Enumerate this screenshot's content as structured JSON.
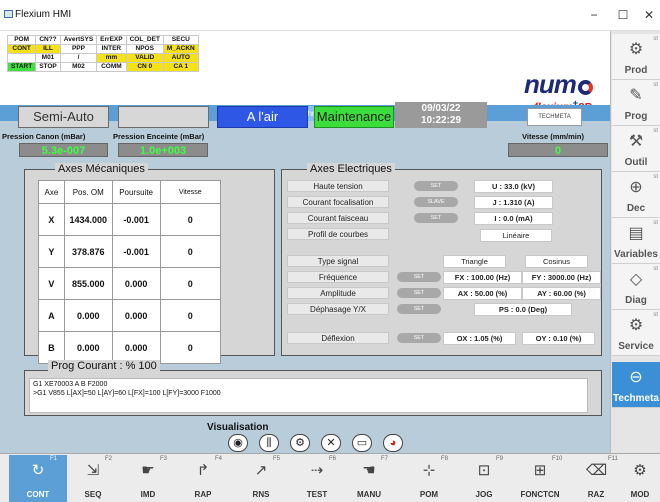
{
  "window": {
    "title": "Flexium HMI",
    "min": "−",
    "max": "☐",
    "close": "✕"
  },
  "status_grid": [
    [
      "POM",
      "CN??",
      "AvertSYS",
      "ErrEXP",
      "COL_DET",
      "SECU"
    ],
    [
      "CONT",
      "ILL",
      "PPP",
      "INTER",
      "NPOS",
      "M_ACKN"
    ],
    [
      "",
      "M01",
      "/",
      "mm",
      "VALID",
      "AUTO"
    ],
    [
      "START",
      "STOP",
      "M02",
      "COMM",
      "CN 0",
      "CA 1"
    ]
  ],
  "logo": {
    "main": "num",
    "sub_left": "flexium",
    "sub_plus": "+",
    "sub_right": "8B"
  },
  "header_tab": "Techmeta",
  "modes": {
    "semi_auto": "Semi-Auto",
    "blank": "",
    "a_lair": "A l'air",
    "maintenance": "Maintenance"
  },
  "datetime": {
    "date": "09/03/22",
    "time": "10:22:29"
  },
  "techmeta_logo": "TECHMETA",
  "sensors": {
    "canon_label": "Pression Canon (mBar)",
    "canon_value": "5.3e-007",
    "enceinte_label": "Pression Enceinte (mBar)",
    "enceinte_value": "1.0e+003",
    "vitesse_label": "Vitesse (mm/min)",
    "vitesse_value": "0"
  },
  "mech": {
    "title": "Axes Mécaniques",
    "headers": [
      "Axe",
      "Pos. OM",
      "Poursuite",
      "Vitesse"
    ],
    "rows": [
      [
        "X",
        "1434.000",
        "-0.001",
        "0"
      ],
      [
        "Y",
        "378.876",
        "-0.001",
        "0"
      ],
      [
        "V",
        "855.000",
        "0.000",
        "0"
      ],
      [
        "A",
        "0.000",
        "0.000",
        "0"
      ],
      [
        "B",
        "0.000",
        "0.000",
        "0"
      ]
    ]
  },
  "elec": {
    "title": "Axes Electriques",
    "haute_tension": "Haute tension",
    "ht_btn": "SET",
    "ht_val": "U : 33.0 (kV)",
    "courant_foc": "Courant focalisation",
    "cf_btn": "SLAVE",
    "cf_val": "J : 1.310 (A)",
    "courant_fais": "Courant faisceau",
    "cfa_btn": "SET",
    "cfa_val": "I : 0.0 (mA)",
    "profil": "Profil de courbes",
    "profil_val": "Linéaire",
    "type_signal": "Type signal",
    "ts_val1": "Triangle",
    "ts_val2": "Cosinus",
    "frequence": "Fréquence",
    "freq_btn": "SET",
    "freq_val1": "FX : 100.00 (Hz)",
    "freq_val2": "FY : 3000.00 (Hz)",
    "amplitude": "Amplitude",
    "amp_btn": "SET",
    "amp_val1": "AX : 50.00 (%)",
    "amp_val2": "AY : 60.00 (%)",
    "dephasage": "Déphasage Y/X",
    "deph_btn": "SET",
    "deph_val": "PS : 0.0 (Deg)",
    "deflexion": "Déflexion",
    "defl_btn": "SET",
    "defl_val1": "OX : 1.05 (%)",
    "defl_val2": "OY : 0.10 (%)"
  },
  "prog": {
    "title": "Prog Courant : % 100",
    "text": "G1 XE70003 A B F2000\n>G1 V855 L[AX]=50 L[AY]=60 L[FX]=100 L[FY]=3000 F1000"
  },
  "visualisation": {
    "title": "Visualisation"
  },
  "right_menu": [
    {
      "label": "Prod",
      "icon": "gears-icon"
    },
    {
      "label": "Prog",
      "icon": "program-icon"
    },
    {
      "label": "Outil",
      "icon": "tool-icon"
    },
    {
      "label": "Dec",
      "icon": "offset-icon"
    },
    {
      "label": "Variables",
      "icon": "variables-icon"
    },
    {
      "label": "Diag",
      "icon": "diag-icon"
    },
    {
      "label": "Service",
      "icon": "service-icon"
    },
    {
      "label": "Techmeta",
      "icon": "techmeta-icon"
    }
  ],
  "bottom_menu": [
    {
      "key": "F1",
      "label": "CONT"
    },
    {
      "key": "F2",
      "label": "SEQ"
    },
    {
      "key": "F3",
      "label": "IMD"
    },
    {
      "key": "F4",
      "label": "RAP"
    },
    {
      "key": "F5",
      "label": "RNS"
    },
    {
      "key": "F6",
      "label": "TEST"
    },
    {
      "key": "F7",
      "label": "MANU"
    },
    {
      "key": "F8",
      "label": "POM"
    },
    {
      "key": "F9",
      "label": "JOG"
    },
    {
      "key": "F10",
      "label": "FONCTCN"
    },
    {
      "key": "F11",
      "label": "RAZ"
    },
    {
      "key": "",
      "label": "MOD"
    }
  ],
  "colors": {
    "accent_blue": "#5c9fd6",
    "green_value": "#40ff40",
    "blue_mode": "#2f57e6",
    "green_mode": "#3ddc3d"
  }
}
